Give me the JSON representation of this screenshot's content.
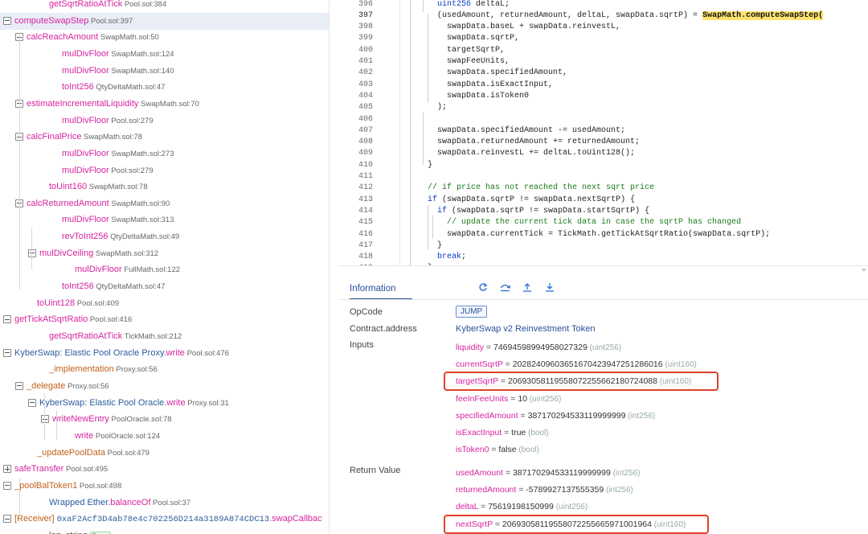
{
  "tree": [
    {
      "indent": 2,
      "toggle": "none",
      "name": "getSqrtRatioAtTick",
      "loc": "Pool.sol:384"
    },
    {
      "indent": 0,
      "toggle": "minus",
      "name": "computeSwapStep",
      "loc": "Pool.sol:397",
      "selected": true
    },
    {
      "indent": 1,
      "toggle": "minus",
      "name": "calcReachAmount",
      "loc": "SwapMath.sol:50"
    },
    {
      "indent": 3,
      "toggle": "none",
      "name": "mulDivFloor",
      "loc": "SwapMath.sol:124"
    },
    {
      "indent": 3,
      "toggle": "none",
      "name": "mulDivFloor",
      "loc": "SwapMath.sol:140"
    },
    {
      "indent": 3,
      "toggle": "none",
      "name": "toInt256",
      "loc": "QtyDeltaMath.sol:47"
    },
    {
      "indent": 1,
      "toggle": "minus",
      "name": "estimateIncrementalLiquidity",
      "loc": "SwapMath.sol:70"
    },
    {
      "indent": 3,
      "toggle": "none",
      "name": "mulDivFloor",
      "loc": "Pool.sol:279"
    },
    {
      "indent": 1,
      "toggle": "minus",
      "name": "calcFinalPrice",
      "loc": "SwapMath.sol:78"
    },
    {
      "indent": 3,
      "toggle": "none",
      "name": "mulDivFloor",
      "loc": "SwapMath.sol:273"
    },
    {
      "indent": 3,
      "toggle": "none",
      "name": "mulDivFloor",
      "loc": "Pool.sol:279"
    },
    {
      "indent": 2,
      "toggle": "none",
      "name": "toUint160",
      "loc": "SwapMath.sol:78"
    },
    {
      "indent": 1,
      "toggle": "minus",
      "name": "calcReturnedAmount",
      "loc": "SwapMath.sol:90"
    },
    {
      "indent": 3,
      "toggle": "none",
      "name": "mulDivFloor",
      "loc": "SwapMath.sol:313"
    },
    {
      "indent": 3,
      "toggle": "none",
      "name": "revToInt256",
      "loc": "QtyDeltaMath.sol:49"
    },
    {
      "indent": 2,
      "toggle": "minus",
      "name": "mulDivCeiling",
      "loc": "SwapMath.sol:312"
    },
    {
      "indent": 4,
      "toggle": "none",
      "name": "mulDivFloor",
      "loc": "FullMath.sol:122"
    },
    {
      "indent": 3,
      "toggle": "none",
      "name": "toInt256",
      "loc": "QtyDeltaMath.sol:47"
    },
    {
      "indent": 1,
      "toggle": "none",
      "name": "toUint128",
      "loc": "Pool.sol:409"
    },
    {
      "indent": 0,
      "toggle": "minus",
      "name": "getTickAtSqrtRatio",
      "loc": "Pool.sol:416"
    },
    {
      "indent": 2,
      "toggle": "none",
      "name": "getSqrtRatioAtTick",
      "loc": "TickMath.sol:212"
    },
    {
      "indent": 0,
      "toggle": "minus",
      "ctr": "KyberSwap: Elastic Pool Oracle Proxy",
      "name": "write",
      "loc": "Pool.sol:476"
    },
    {
      "indent": 2,
      "toggle": "none",
      "name": "_implementation",
      "loc": "Proxy.sol:56",
      "orange": true
    },
    {
      "indent": 1,
      "toggle": "minus",
      "name": "_delegate",
      "loc": "Proxy.sol:56",
      "orange": true
    },
    {
      "indent": 2,
      "toggle": "minus",
      "ctr": "KyberSwap: Elastic Pool Oracle",
      "name": "write",
      "loc": "Proxy.sol:31"
    },
    {
      "indent": 3,
      "toggle": "minus",
      "name": "writeNewEntry",
      "loc": "PoolOracle.sol:78"
    },
    {
      "indent": 4,
      "toggle": "none",
      "name": "write",
      "loc": "PoolOracle.sol:124"
    },
    {
      "indent": 1,
      "toggle": "none",
      "name": "_updatePoolData",
      "loc": "Pool.sol:479",
      "orange": true
    },
    {
      "indent": 0,
      "toggle": "plus",
      "name": "safeTransfer",
      "loc": "Pool.sol:495"
    },
    {
      "indent": 0,
      "toggle": "minus",
      "name": "_poolBalToken1",
      "loc": "Pool.sol:498",
      "orange": true
    },
    {
      "indent": 2,
      "toggle": "none",
      "ctr": "Wrapped Ether",
      "name": "balanceOf",
      "loc": "Pool.sol:37"
    },
    {
      "indent": 0,
      "toggle": "minus",
      "receiver": "[Receiver]",
      "addr": "0xaF2Acf3D4ab78e4c702256D214a3189A874CDC13",
      "name": ".swapCallbac",
      "loc": ""
    },
    {
      "indent": 2,
      "toggle": "none",
      "name": "log_string",
      "loc": "",
      "event": "Event",
      "gray": true
    }
  ],
  "code": {
    "current_line": 397,
    "lines": [
      {
        "n": 396,
        "t": "    uint256 deltaL;"
      },
      {
        "n": 397,
        "t": "    (usedAmount, returnedAmount, deltaL, swapData.sqrtP) = ",
        "hl": "SwapMath.computeSwapStep("
      },
      {
        "n": 398,
        "t": "      swapData.baseL + swapData.reinvestL,"
      },
      {
        "n": 399,
        "t": "      swapData.sqrtP,"
      },
      {
        "n": 400,
        "t": "      targetSqrtP,"
      },
      {
        "n": 401,
        "t": "      swapFeeUnits,"
      },
      {
        "n": 402,
        "t": "      swapData.specifiedAmount,"
      },
      {
        "n": 403,
        "t": "      swapData.isExactInput,"
      },
      {
        "n": 404,
        "t": "      swapData.isToken0"
      },
      {
        "n": 405,
        "t": "    );"
      },
      {
        "n": 406,
        "t": ""
      },
      {
        "n": 407,
        "t": "    swapData.specifiedAmount -= usedAmount;"
      },
      {
        "n": 408,
        "t": "    swapData.returnedAmount += returnedAmount;"
      },
      {
        "n": 409,
        "t": "    swapData.reinvestL += deltaL.toUint128();"
      },
      {
        "n": 410,
        "t": "  }"
      },
      {
        "n": 411,
        "t": ""
      },
      {
        "n": 412,
        "t": "  // if price has not reached the next sqrt price",
        "comment": true
      },
      {
        "n": 413,
        "t": "  if (swapData.sqrtP != swapData.nextSqrtP) {"
      },
      {
        "n": 414,
        "t": "    if (swapData.sqrtP != swapData.startSqrtP) {"
      },
      {
        "n": 415,
        "t": "      // update the current tick data in case the sqrtP has changed",
        "comment": true
      },
      {
        "n": 416,
        "t": "      swapData.currentTick = TickMath.getTickAtSqrtRatio(swapData.sqrtP);"
      },
      {
        "n": 417,
        "t": "    }"
      },
      {
        "n": 418,
        "t": "    break;"
      },
      {
        "n": 419,
        "t": "  }"
      }
    ]
  },
  "info": {
    "tab": "Information",
    "toolbar_icons": [
      "rotate-icon",
      "step-over-icon",
      "step-out-icon",
      "step-into-icon"
    ],
    "opcode_label": "OpCode",
    "opcode": "JUMP",
    "contract_label": "Contract.address",
    "contract": "KyberSwap v2 Reinvestment Token",
    "inputs_label": "Inputs",
    "inputs": [
      {
        "name": "liquidity",
        "value": "74694598994958027329",
        "type": "(uint256)"
      },
      {
        "name": "currentSqrtP",
        "value": "20282409603651670423947251286016",
        "type": "(uint160)"
      },
      {
        "name": "targetSqrtP",
        "value": "20693058119558072255662180724088",
        "type": "(uint160)",
        "boxed": true
      },
      {
        "name": "feeInFeeUnits",
        "value": "10",
        "type": "(uint256)"
      },
      {
        "name": "specifiedAmount",
        "value": "387170294533119999999",
        "type": "(int256)"
      },
      {
        "name": "isExactInput",
        "value": "true",
        "type": "(bool)"
      },
      {
        "name": "isToken0",
        "value": "false",
        "type": "(bool)"
      }
    ],
    "return_label": "Return Value",
    "returns": [
      {
        "name": "usedAmount",
        "value": "387170294533119999999",
        "type": "(int256)"
      },
      {
        "name": "returnedAmount",
        "value": "-5789927137555359",
        "type": "(int256)"
      },
      {
        "name": "deltaL",
        "value": "75619198150999",
        "type": "(uint256)"
      },
      {
        "name": "nextSqrtP",
        "value": "20693058119558072255665971001964",
        "type": "(uint160)",
        "boxed": true
      }
    ]
  }
}
